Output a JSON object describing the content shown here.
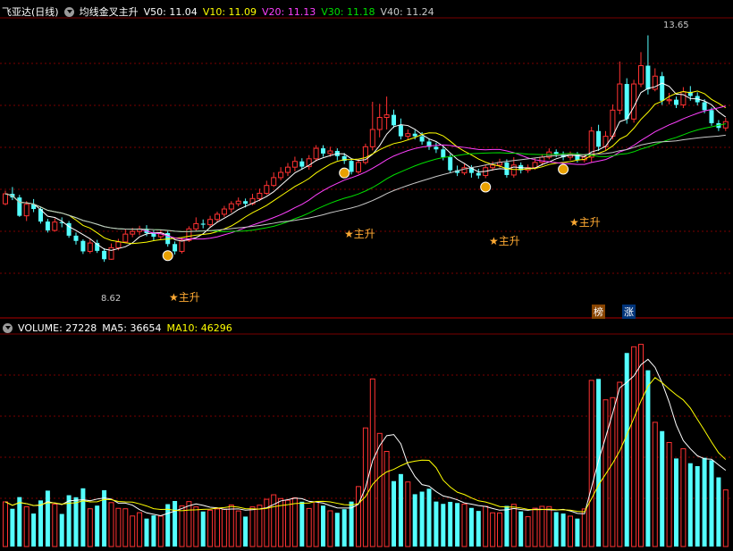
{
  "header": {
    "stock_name": "飞亚达(日线)",
    "indicator_name": "均线金叉主升",
    "ma_values": [
      {
        "label": "V50: 11.04",
        "color": "#ffffff"
      },
      {
        "label": "V10: 11.09",
        "color": "#ffff00"
      },
      {
        "label": "V20: 11.13",
        "color": "#ff40ff"
      },
      {
        "label": "V30: 11.18",
        "color": "#00e000"
      },
      {
        "label": "V40: 11.24",
        "color": "#c8c8c8"
      }
    ]
  },
  "volume_header": {
    "volume": "VOLUME: 27228",
    "ma5": "MA5: 36654",
    "ma10": "MA10: 46296"
  },
  "annotations": {
    "high_label": "13.65",
    "low_label": "8.62",
    "signal_label": "主升",
    "badge_1": "榜",
    "badge_2": "涨"
  },
  "colors": {
    "up": "#ff3232",
    "down": "#54ffff",
    "grid": "#7a0000",
    "signal": "#ffaa33"
  },
  "candles": [
    [
      10.43,
      10.62,
      10.68,
      10.4,
      310
    ],
    [
      10.62,
      10.55,
      10.75,
      10.5,
      262
    ],
    [
      10.55,
      10.2,
      10.6,
      10.18,
      343
    ],
    [
      10.2,
      10.42,
      10.48,
      10.1,
      276
    ],
    [
      10.42,
      10.33,
      10.52,
      10.27,
      229
    ],
    [
      10.33,
      10.09,
      10.38,
      10.05,
      320
    ],
    [
      10.09,
      9.92,
      10.14,
      9.88,
      388
    ],
    [
      9.92,
      10.08,
      10.15,
      9.9,
      294
    ],
    [
      10.08,
      10.06,
      10.17,
      9.98,
      226
    ],
    [
      10.06,
      9.82,
      10.1,
      9.78,
      356
    ],
    [
      9.82,
      9.72,
      9.88,
      9.65,
      342
    ],
    [
      9.72,
      9.52,
      9.75,
      9.47,
      404
    ],
    [
      9.52,
      9.68,
      9.76,
      9.48,
      262
    ],
    [
      9.68,
      9.53,
      9.74,
      9.49,
      284
    ],
    [
      9.53,
      9.37,
      9.58,
      9.32,
      391
    ],
    [
      9.37,
      9.59,
      9.67,
      9.36,
      305
    ],
    [
      9.59,
      9.7,
      9.76,
      9.54,
      265
    ],
    [
      9.7,
      9.85,
      9.94,
      9.68,
      262
    ],
    [
      9.85,
      9.9,
      9.97,
      9.79,
      212
    ],
    [
      9.9,
      9.95,
      10.01,
      9.83,
      235
    ],
    [
      9.95,
      9.87,
      10.02,
      9.81,
      194
    ],
    [
      9.87,
      9.8,
      9.92,
      9.73,
      216
    ],
    [
      9.8,
      9.87,
      9.94,
      9.74,
      211
    ],
    [
      9.87,
      9.66,
      9.91,
      9.61,
      294
    ],
    [
      9.66,
      9.52,
      9.71,
      9.46,
      316
    ],
    [
      9.52,
      9.73,
      9.79,
      9.48,
      282
    ],
    [
      9.73,
      9.95,
      10.0,
      9.7,
      312
    ],
    [
      9.95,
      10.05,
      10.17,
      9.9,
      275
    ],
    [
      10.05,
      10.03,
      10.13,
      9.96,
      243
    ],
    [
      10.03,
      10.13,
      10.2,
      9.98,
      252
    ],
    [
      10.13,
      10.23,
      10.28,
      10.08,
      261
    ],
    [
      10.23,
      10.33,
      10.39,
      10.18,
      259
    ],
    [
      10.33,
      10.43,
      10.48,
      10.26,
      288
    ],
    [
      10.43,
      10.48,
      10.55,
      10.38,
      247
    ],
    [
      10.48,
      10.43,
      10.53,
      10.36,
      208
    ],
    [
      10.43,
      10.53,
      10.62,
      10.4,
      275
    ],
    [
      10.53,
      10.63,
      10.72,
      10.48,
      287
    ],
    [
      10.63,
      10.78,
      10.87,
      10.6,
      328
    ],
    [
      10.78,
      10.93,
      11.03,
      10.75,
      359
    ],
    [
      10.93,
      11.03,
      11.13,
      10.88,
      333
    ],
    [
      11.03,
      11.13,
      11.21,
      10.96,
      321
    ],
    [
      11.13,
      11.24,
      11.33,
      11.05,
      338
    ],
    [
      11.24,
      11.14,
      11.3,
      11.08,
      311
    ],
    [
      11.14,
      11.29,
      11.36,
      11.08,
      264
    ],
    [
      11.29,
      11.49,
      11.55,
      11.24,
      310
    ],
    [
      11.49,
      11.39,
      11.55,
      11.33,
      284
    ],
    [
      11.39,
      11.44,
      11.52,
      11.33,
      248
    ],
    [
      11.44,
      11.34,
      11.49,
      11.26,
      234
    ],
    [
      11.34,
      11.25,
      11.4,
      11.19,
      259
    ],
    [
      11.25,
      11.04,
      11.29,
      10.99,
      312
    ],
    [
      11.04,
      11.22,
      11.29,
      11.0,
      416
    ],
    [
      11.22,
      11.52,
      11.58,
      11.18,
      823
    ],
    [
      11.52,
      11.85,
      12.38,
      11.45,
      1163
    ],
    [
      11.85,
      12.08,
      12.34,
      11.7,
      785
    ],
    [
      12.08,
      12.13,
      12.48,
      11.85,
      660
    ],
    [
      12.13,
      11.93,
      12.23,
      11.88,
      454
    ],
    [
      11.93,
      11.72,
      12.06,
      11.66,
      503
    ],
    [
      11.72,
      11.77,
      11.85,
      11.66,
      448
    ],
    [
      11.77,
      11.72,
      11.84,
      11.66,
      363
    ],
    [
      11.72,
      11.62,
      11.8,
      11.56,
      381
    ],
    [
      11.62,
      11.52,
      11.68,
      11.46,
      401
    ],
    [
      11.52,
      11.47,
      11.6,
      11.4,
      312
    ],
    [
      11.47,
      11.32,
      11.52,
      11.26,
      296
    ],
    [
      11.32,
      11.07,
      11.38,
      11.02,
      310
    ],
    [
      11.07,
      11.02,
      11.16,
      10.96,
      302
    ],
    [
      11.02,
      11.12,
      11.19,
      10.98,
      294
    ],
    [
      11.12,
      11.02,
      11.17,
      10.93,
      268
    ],
    [
      11.02,
      10.97,
      11.1,
      10.91,
      247
    ],
    [
      10.97,
      11.12,
      11.18,
      10.92,
      279
    ],
    [
      11.12,
      11.17,
      11.24,
      11.06,
      234
    ],
    [
      11.17,
      11.22,
      11.29,
      11.12,
      233
    ],
    [
      11.22,
      10.98,
      11.28,
      10.93,
      282
    ],
    [
      10.98,
      11.17,
      11.32,
      10.93,
      293
    ],
    [
      11.17,
      11.07,
      11.22,
      11.01,
      244
    ],
    [
      11.07,
      11.12,
      11.18,
      11.02,
      207
    ],
    [
      11.12,
      11.22,
      11.3,
      11.08,
      266
    ],
    [
      11.22,
      11.32,
      11.38,
      11.16,
      279
    ],
    [
      11.32,
      11.42,
      11.49,
      11.28,
      277
    ],
    [
      11.42,
      11.37,
      11.47,
      11.32,
      239
    ],
    [
      11.37,
      11.32,
      11.43,
      11.26,
      229
    ],
    [
      11.32,
      11.37,
      11.43,
      11.26,
      211
    ],
    [
      11.37,
      11.27,
      11.42,
      11.22,
      194
    ],
    [
      11.27,
      11.32,
      11.37,
      11.22,
      261
    ],
    [
      11.32,
      11.82,
      11.9,
      11.22,
      1153
    ],
    [
      11.82,
      11.52,
      11.94,
      11.44,
      1163
    ],
    [
      11.52,
      11.72,
      11.82,
      11.46,
      1018
    ],
    [
      11.72,
      12.22,
      12.33,
      11.66,
      1033
    ],
    [
      12.22,
      12.72,
      13.15,
      12.14,
      1140
    ],
    [
      12.72,
      12.05,
      12.83,
      11.96,
      1343
    ],
    [
      12.05,
      12.72,
      12.8,
      11.98,
      1386
    ],
    [
      12.72,
      13.07,
      13.33,
      12.66,
      1403
    ],
    [
      13.07,
      12.62,
      13.65,
      12.52,
      1223
    ],
    [
      12.62,
      12.87,
      13.02,
      12.58,
      862
    ],
    [
      12.87,
      12.4,
      12.95,
      12.32,
      801
    ],
    [
      12.4,
      12.42,
      12.55,
      12.33,
      722
    ],
    [
      12.42,
      12.32,
      12.48,
      12.26,
      611
    ],
    [
      12.32,
      12.57,
      12.66,
      12.26,
      679
    ],
    [
      12.57,
      12.49,
      12.68,
      12.4,
      578
    ],
    [
      12.49,
      12.37,
      12.56,
      12.31,
      558
    ],
    [
      12.37,
      12.22,
      12.43,
      12.16,
      616
    ],
    [
      12.22,
      11.97,
      12.27,
      11.92,
      599
    ],
    [
      11.97,
      11.88,
      12.03,
      11.82,
      480
    ],
    [
      11.88,
      12.0,
      12.07,
      11.82,
      393
    ]
  ]
}
